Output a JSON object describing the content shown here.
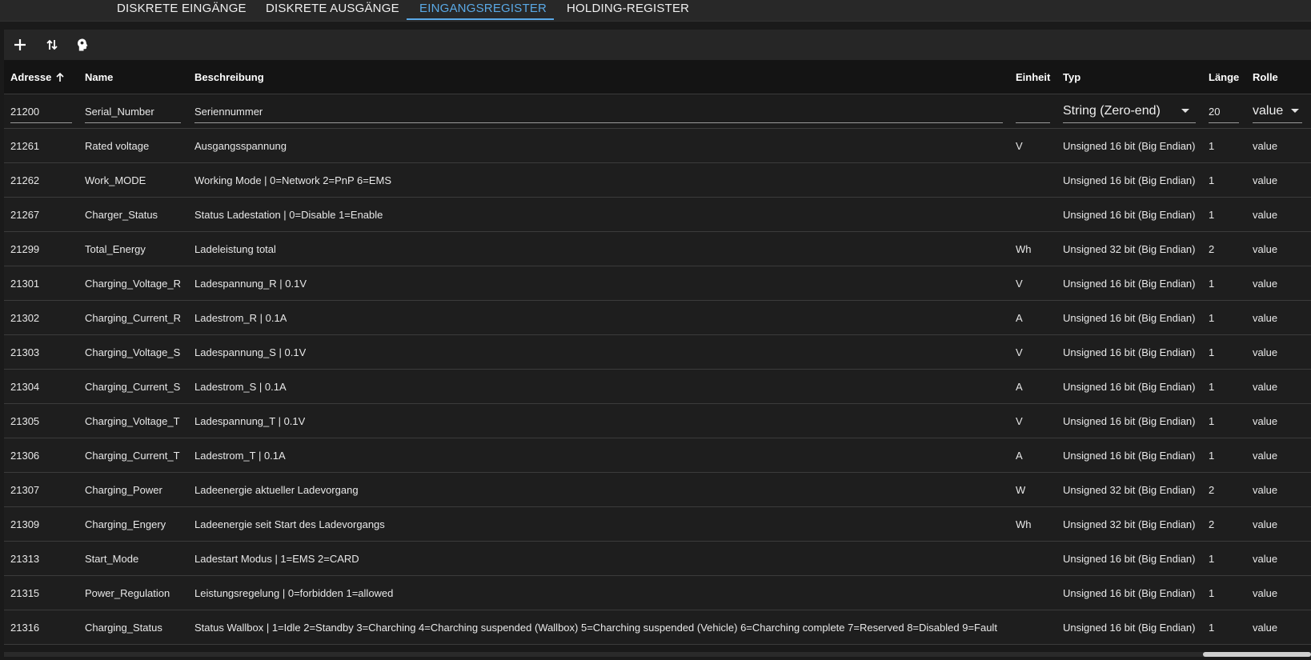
{
  "tabs": [
    {
      "label": "Diskrete Eingänge",
      "active": false
    },
    {
      "label": "Diskrete Ausgänge",
      "active": false
    },
    {
      "label": "Eingangsregister",
      "active": true
    },
    {
      "label": "Holding-Register",
      "active": false
    }
  ],
  "toolbar": {
    "add_icon": "plus-icon",
    "sort_icon": "swap-vertical-icon",
    "import_icon": "head-icon"
  },
  "table": {
    "headers": {
      "address": "Adresse",
      "name": "Name",
      "description": "Beschreibung",
      "unit": "Einheit",
      "type": "Typ",
      "length": "Länge",
      "role": "Rolle"
    },
    "sort_column": "address",
    "sort_direction": "ascending",
    "edit_row": {
      "address": "21200",
      "name": "Serial_Number",
      "description": "Seriennummer",
      "unit": "",
      "type": "String (Zero-end)",
      "length": "20",
      "role": "value"
    },
    "rows": [
      {
        "address": "21261",
        "name": "Rated voltage",
        "description": "Ausgangsspannung",
        "unit": "V",
        "type": "Unsigned 16 bit (Big Endian)",
        "length": "1",
        "role": "value"
      },
      {
        "address": "21262",
        "name": "Work_MODE",
        "description": "Working Mode | 0=Network 2=PnP 6=EMS",
        "unit": "",
        "type": "Unsigned 16 bit (Big Endian)",
        "length": "1",
        "role": "value"
      },
      {
        "address": "21267",
        "name": "Charger_Status",
        "description": "Status Ladestation | 0=Disable 1=Enable",
        "unit": "",
        "type": "Unsigned 16 bit (Big Endian)",
        "length": "1",
        "role": "value"
      },
      {
        "address": "21299",
        "name": "Total_Energy",
        "description": "Ladeleistung total",
        "unit": "Wh",
        "type": "Unsigned 32 bit (Big Endian)",
        "length": "2",
        "role": "value"
      },
      {
        "address": "21301",
        "name": "Charging_Voltage_R",
        "description": "Ladespannung_R | 0.1V",
        "unit": "V",
        "type": "Unsigned 16 bit (Big Endian)",
        "length": "1",
        "role": "value"
      },
      {
        "address": "21302",
        "name": "Charging_Current_R",
        "description": "Ladestrom_R | 0.1A",
        "unit": "A",
        "type": "Unsigned 16 bit (Big Endian)",
        "length": "1",
        "role": "value"
      },
      {
        "address": "21303",
        "name": "Charging_Voltage_S",
        "description": "Ladespannung_S | 0.1V",
        "unit": "V",
        "type": "Unsigned 16 bit (Big Endian)",
        "length": "1",
        "role": "value"
      },
      {
        "address": "21304",
        "name": "Charging_Current_S",
        "description": "Ladestrom_S | 0.1A",
        "unit": "A",
        "type": "Unsigned 16 bit (Big Endian)",
        "length": "1",
        "role": "value"
      },
      {
        "address": "21305",
        "name": "Charging_Voltage_T",
        "description": "Ladespannung_T | 0.1V",
        "unit": "V",
        "type": "Unsigned 16 bit (Big Endian)",
        "length": "1",
        "role": "value"
      },
      {
        "address": "21306",
        "name": "Charging_Current_T",
        "description": "Ladestrom_T | 0.1A",
        "unit": "A",
        "type": "Unsigned 16 bit (Big Endian)",
        "length": "1",
        "role": "value"
      },
      {
        "address": "21307",
        "name": "Charging_Power",
        "description": "Ladeenergie aktueller Ladevorgang",
        "unit": "W",
        "type": "Unsigned 32 bit (Big Endian)",
        "length": "2",
        "role": "value"
      },
      {
        "address": "21309",
        "name": "Charging_Engery",
        "description": "Ladeenergie seit Start des Ladevorgangs",
        "unit": "Wh",
        "type": "Unsigned 32 bit (Big Endian)",
        "length": "2",
        "role": "value"
      },
      {
        "address": "21313",
        "name": "Start_Mode",
        "description": "Ladestart Modus | 1=EMS 2=CARD",
        "unit": "",
        "type": "Unsigned 16 bit (Big Endian)",
        "length": "1",
        "role": "value"
      },
      {
        "address": "21315",
        "name": "Power_Regulation",
        "description": "Leistungsregelung | 0=forbidden 1=allowed",
        "unit": "",
        "type": "Unsigned 16 bit (Big Endian)",
        "length": "1",
        "role": "value"
      },
      {
        "address": "21316",
        "name": "Charging_Status",
        "description": "Status Wallbox | 1=Idle 2=Standby 3=Charching 4=Charching suspended (Wallbox) 5=Charching suspended (Vehicle) 6=Charching complete 7=Reserved 8=Disabled 9=Fault",
        "unit": "",
        "type": "Unsigned 16 bit (Big Endian)",
        "length": "1",
        "role": "value"
      }
    ]
  },
  "scrollbar": {
    "horizontal_position_fraction": 0.92
  },
  "colors": {
    "accent": "#5aa9e6",
    "background": "#1a1a1a",
    "header_background": "#141414"
  }
}
